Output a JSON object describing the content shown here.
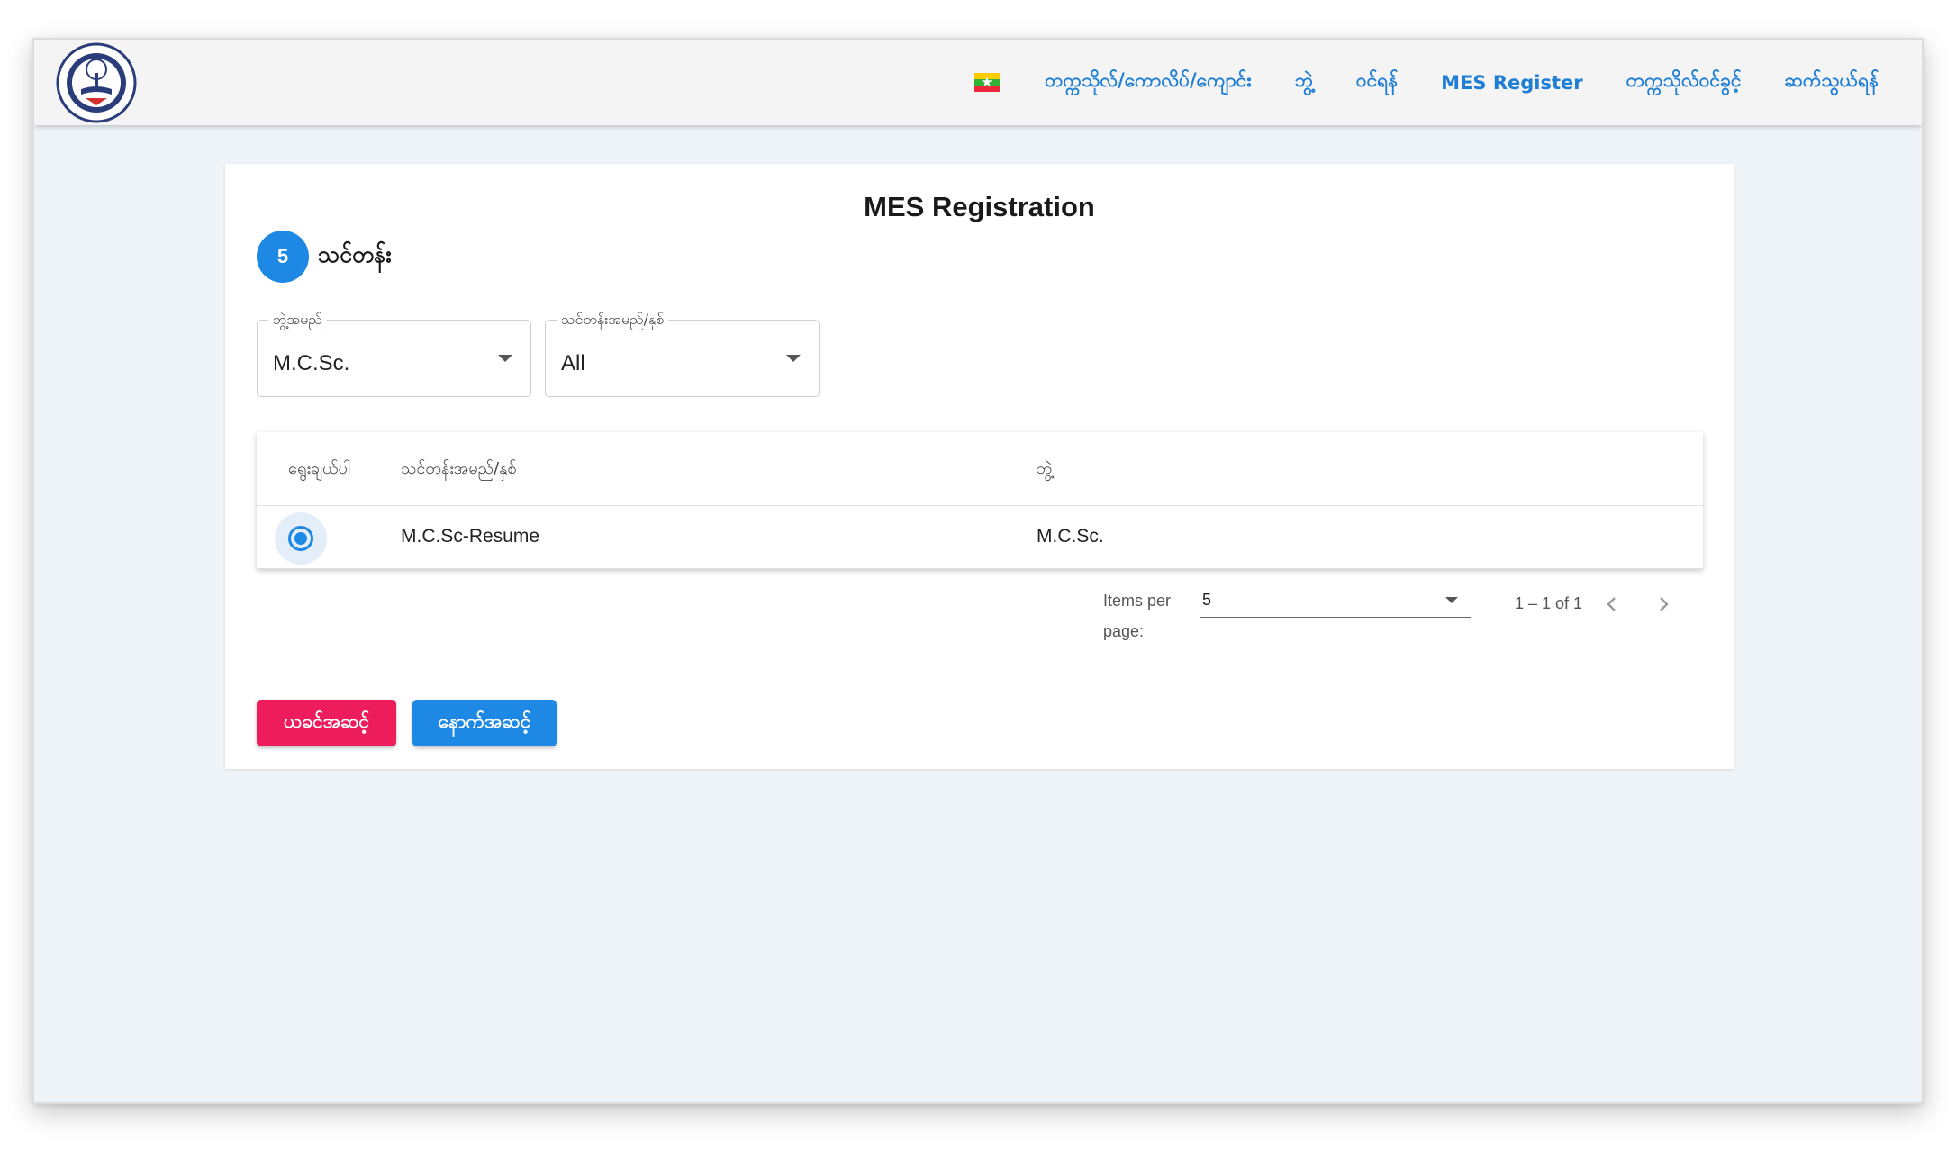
{
  "nav": {
    "flag_icon": "myanmar-flag-icon",
    "items": [
      {
        "label": "တက္ကသိုလ်/ကောလိပ်/ကျောင်း"
      },
      {
        "label": "ဘွဲ့"
      },
      {
        "label": "ဝင်ရန်"
      },
      {
        "label": "MES Register"
      },
      {
        "label": "တက္ကသိုလ်ဝင်ခွင့်"
      },
      {
        "label": "ဆက်သွယ်ရန်"
      }
    ]
  },
  "card": {
    "title": "MES Registration",
    "step": {
      "number": "5",
      "label": "သင်တန်း"
    }
  },
  "filters": {
    "degree": {
      "legend": "ဘွဲ့အမည်",
      "value": "M.C.Sc."
    },
    "course": {
      "legend": "သင်တန်းအမည်/နှစ်",
      "value": "All"
    }
  },
  "table": {
    "headers": [
      "ရွေးချယ်ပါ",
      "သင်တန်းအမည်/နှစ်",
      "ဘွဲ့"
    ],
    "rows": [
      {
        "selected": true,
        "course": "M.C.Sc-Resume",
        "degree": "M.C.Sc."
      }
    ]
  },
  "paginator": {
    "items_per_page_label": "Items per page:",
    "page_size": "5",
    "range": "1 – 1 of 1"
  },
  "buttons": {
    "previous": "ယခင်အဆင့်",
    "next": "နောက်အဆင့်"
  },
  "colors": {
    "accent": "#1e88e5",
    "nav_link": "#1e7ed6",
    "previous_button": "#ed1c5c",
    "background": "#edf3f7"
  }
}
